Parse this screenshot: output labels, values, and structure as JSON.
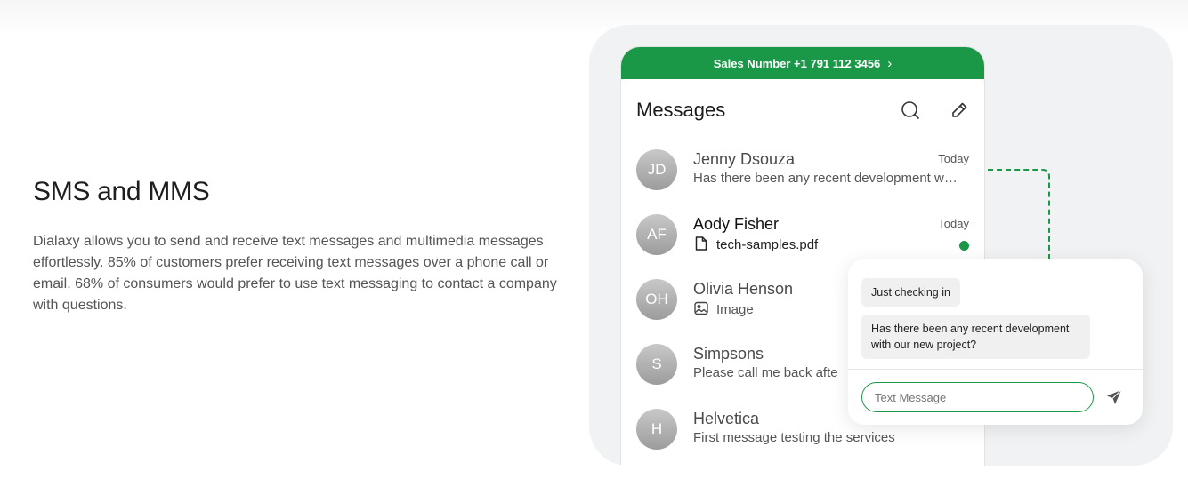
{
  "feature": {
    "title": "SMS and MMS",
    "description": "Dialaxy allows you to send and receive text messages and multimedia messages effortlessly. 85% of customers prefer receiving text messages over a phone call or email. 68% of consumers would prefer to use text messaging to contact a company with questions."
  },
  "phone": {
    "sales_number": "Sales Number +1 791 112 3456",
    "header_title": "Messages",
    "header_icons": [
      "search-icon",
      "edit-pencil-icon"
    ],
    "conversations": [
      {
        "initials": "JD",
        "name": "Jenny Dsouza",
        "time": "Today",
        "preview": "Has there been any recent development with our new project?",
        "preview_icon": "",
        "unread": false
      },
      {
        "initials": "AF",
        "name": "Aody Fisher",
        "time": "Today",
        "preview": "tech-samples.pdf",
        "preview_icon": "file-icon",
        "unread": true
      },
      {
        "initials": "OH",
        "name": "Olivia Henson",
        "time": "",
        "preview": "Image",
        "preview_icon": "image-icon",
        "unread": false
      },
      {
        "initials": "S",
        "name": "Simpsons",
        "time": "",
        "preview": "Please call me back afte",
        "preview_icon": "",
        "unread": false
      },
      {
        "initials": "H",
        "name": "Helvetica",
        "time": "",
        "preview": "First message testing the services",
        "preview_icon": "",
        "unread": false
      }
    ]
  },
  "chat": {
    "messages": [
      "Just checking in",
      "Has there been any recent development with our new project?"
    ],
    "input_placeholder": "Text Message",
    "send_icon": "send-icon"
  },
  "colors": {
    "accent": "#1a9848",
    "panel_bg": "#f1f2f3"
  }
}
